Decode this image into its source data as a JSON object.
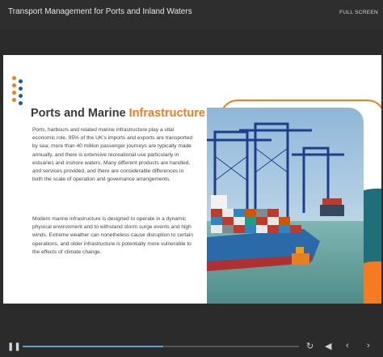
{
  "window": {
    "title": "Transport Management for Ports and Inland Waters",
    "fullscreen_label": "FULL SCREEN"
  },
  "slide": {
    "heading_main": "Ports and Marine ",
    "heading_accent": "Infrastructure",
    "paragraph1": "Ports, harbours and related marine infrastructure play a vital economic role. 95% of the UK's imports and exports are transported by sea; more than 40 million passenger journeys are typically made annually, and there is extensive recreational use particularly in estuaries and inshore waters. Many different products are handled, and services provided, and there are considerable differences in both the scale of operation and governance arrangements.",
    "paragraph2": "Modern marine infrastructure is designed to operate in a dynamic physical environment and to withstand storm surge events and high winds. Extreme weather can nonetheless cause disruption to certain operations, and older infrastructure is potentially more vulnerable to the effects of climate change.",
    "image_alt": "container-ship-at-port-cranes"
  },
  "colors": {
    "accent": "#f47b20",
    "teal": "#1e6f7a",
    "dot_blue": "#1f5f8b",
    "progress": "#5aa0d8"
  },
  "player": {
    "progress": 0.51,
    "icons": [
      "pause-icon",
      "replay-icon",
      "volume-icon",
      "prev-icon",
      "next-icon"
    ]
  }
}
